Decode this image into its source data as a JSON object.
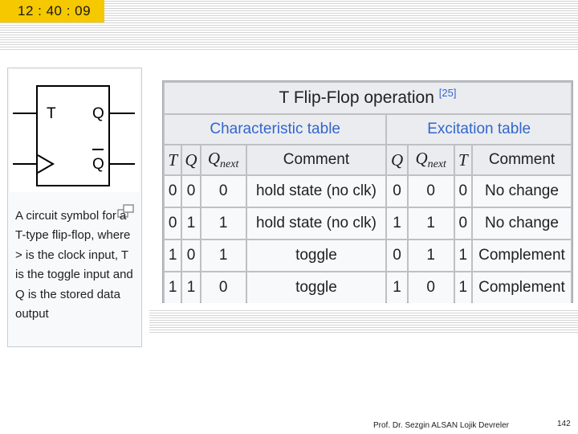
{
  "clock": {
    "time": "12 : 40 : 09"
  },
  "figure": {
    "symbol": {
      "label_t": "T",
      "label_q": "Q",
      "label_qbar": "Q"
    },
    "caption": "A circuit symbol for a T-type flip-flop, where > is the clock input, T is the toggle input and Q is the stored data output",
    "icon": "magnify-clip-icon"
  },
  "table": {
    "title": "T Flip-Flop operation",
    "ref": "[25]",
    "characteristic_heading": "Characteristic table",
    "excitation_heading": "Excitation table",
    "characteristic_columns": {
      "t": "T",
      "q": "Q",
      "qnext_base": "Q",
      "qnext_sub": "next",
      "comment": "Comment"
    },
    "excitation_columns": {
      "q": "Q",
      "qnext_base": "Q",
      "qnext_sub": "next",
      "t": "T",
      "comment": "Comment"
    },
    "characteristic_rows": [
      {
        "t": "0",
        "q": "0",
        "qnext": "0",
        "comment": "hold state (no clk)"
      },
      {
        "t": "0",
        "q": "1",
        "qnext": "1",
        "comment": "hold state (no clk)"
      },
      {
        "t": "1",
        "q": "0",
        "qnext": "1",
        "comment": "toggle"
      },
      {
        "t": "1",
        "q": "1",
        "qnext": "0",
        "comment": "toggle"
      }
    ],
    "excitation_rows": [
      {
        "q": "0",
        "qnext": "0",
        "t": "0",
        "comment": "No change"
      },
      {
        "q": "1",
        "qnext": "1",
        "t": "0",
        "comment": "No change"
      },
      {
        "q": "0",
        "qnext": "1",
        "t": "1",
        "comment": "Complement"
      },
      {
        "q": "1",
        "qnext": "0",
        "t": "1",
        "comment": "Complement"
      }
    ]
  },
  "footer": {
    "author": "Prof. Dr. Sezgin ALSAN   Lojik Devreler",
    "page": "142"
  },
  "colors": {
    "clock_bg": "#f5c800",
    "link_blue": "#3366cc",
    "header_bg": "#eaecf0",
    "cell_bg": "#f8f9fa"
  }
}
